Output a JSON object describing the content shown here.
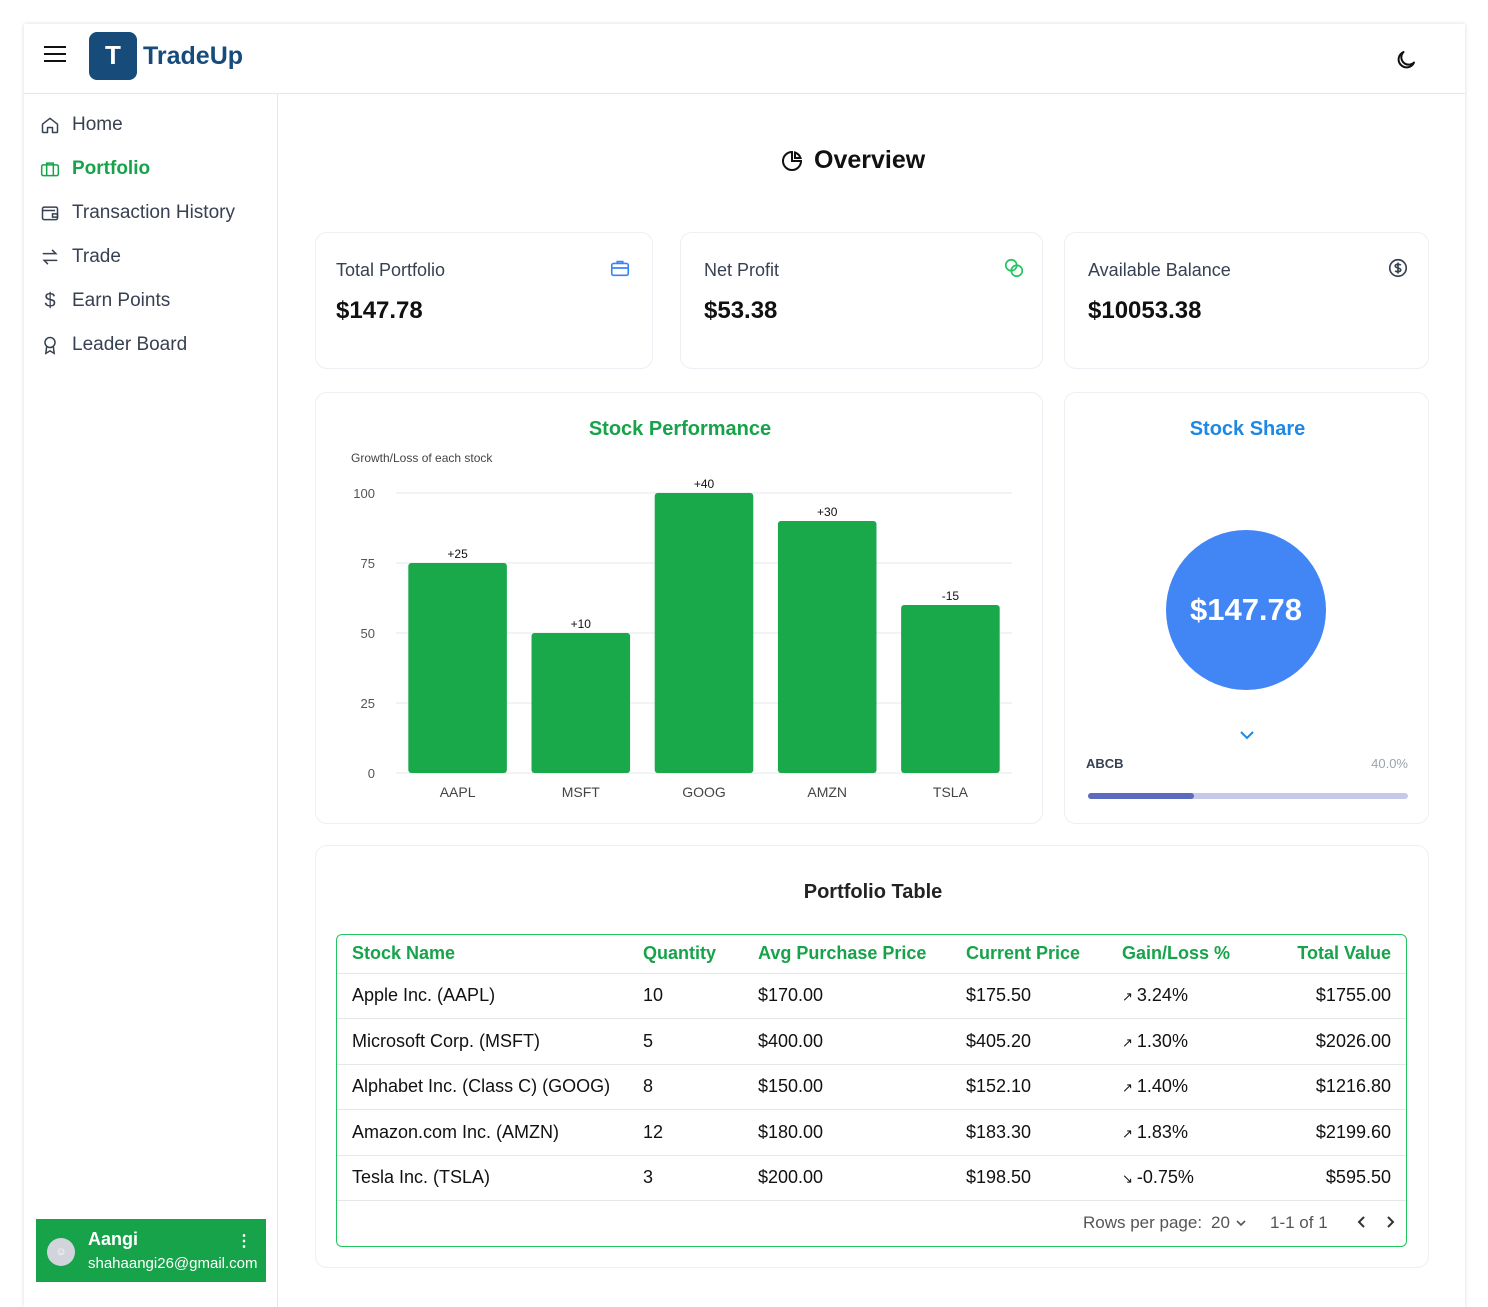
{
  "brand": {
    "logo_letter": "T",
    "name": "TradeUp"
  },
  "sidebar": {
    "items": [
      {
        "label": "Home",
        "icon": "home-icon",
        "active": false
      },
      {
        "label": "Portfolio",
        "icon": "briefcase-icon",
        "active": true
      },
      {
        "label": "Transaction History",
        "icon": "wallet-icon",
        "active": false
      },
      {
        "label": "Trade",
        "icon": "swap-icon",
        "active": false
      },
      {
        "label": "Earn Points",
        "icon": "dollar-icon",
        "active": false
      },
      {
        "label": "Leader Board",
        "icon": "award-icon",
        "active": false
      }
    ],
    "user": {
      "name": "Aangi",
      "email": "shahaangi26@gmail.com"
    }
  },
  "main": {
    "title": "Overview",
    "stats": [
      {
        "label": "Total Portfolio",
        "value": "$147.78",
        "icon": "briefcase-icon",
        "color": "#3b82f6"
      },
      {
        "label": "Net Profit",
        "value": "$53.38",
        "icon": "coins-icon",
        "color": "#22c55e"
      },
      {
        "label": "Available Balance",
        "value": "$10053.38",
        "icon": "dollar-circle-icon",
        "color": "#374151"
      }
    ],
    "performance": {
      "title": "Stock Performance"
    },
    "share": {
      "title": "Stock Share",
      "total": "$147.78",
      "item": {
        "label": "ABCB",
        "percent": "40.0%",
        "fraction": 0.33
      }
    },
    "table": {
      "title": "Portfolio Table",
      "headers": [
        "Stock Name",
        "Quantity",
        "Avg Purchase Price",
        "Current Price",
        "Gain/Loss %",
        "Total Value"
      ],
      "rows": [
        {
          "name": "Apple Inc. (AAPL)",
          "qty": "10",
          "avg": "$170.00",
          "cur": "$175.50",
          "gain": "3.24%",
          "dir": "up",
          "total": "$1755.00"
        },
        {
          "name": "Microsoft Corp. (MSFT)",
          "qty": "5",
          "avg": "$400.00",
          "cur": "$405.20",
          "gain": "1.30%",
          "dir": "up",
          "total": "$2026.00"
        },
        {
          "name": "Alphabet Inc. (Class C) (GOOG)",
          "qty": "8",
          "avg": "$150.00",
          "cur": "$152.10",
          "gain": "1.40%",
          "dir": "up",
          "total": "$1216.80"
        },
        {
          "name": "Amazon.com Inc. (AMZN)",
          "qty": "12",
          "avg": "$180.00",
          "cur": "$183.30",
          "gain": "1.83%",
          "dir": "up",
          "total": "$2199.60"
        },
        {
          "name": "Tesla Inc. (TSLA)",
          "qty": "3",
          "avg": "$200.00",
          "cur": "$198.50",
          "gain": "-0.75%",
          "dir": "down",
          "total": "$595.50"
        }
      ],
      "pager": {
        "rows_label": "Rows per page:",
        "rows_value": "20",
        "range": "1-1 of 1"
      }
    }
  },
  "chart_data": {
    "type": "bar",
    "subtitle": "Growth/Loss of each stock",
    "categories": [
      "AAPL",
      "MSFT",
      "GOOG",
      "AMZN",
      "TSLA"
    ],
    "values": [
      75,
      50,
      100,
      90,
      60
    ],
    "data_labels": [
      "+25",
      "+10",
      "+40",
      "+30",
      "-15"
    ],
    "yticks": [
      "0",
      "25",
      "50",
      "75",
      "100"
    ],
    "ylim": [
      0,
      100
    ],
    "bar_color": "#19a84a",
    "grid": true
  }
}
